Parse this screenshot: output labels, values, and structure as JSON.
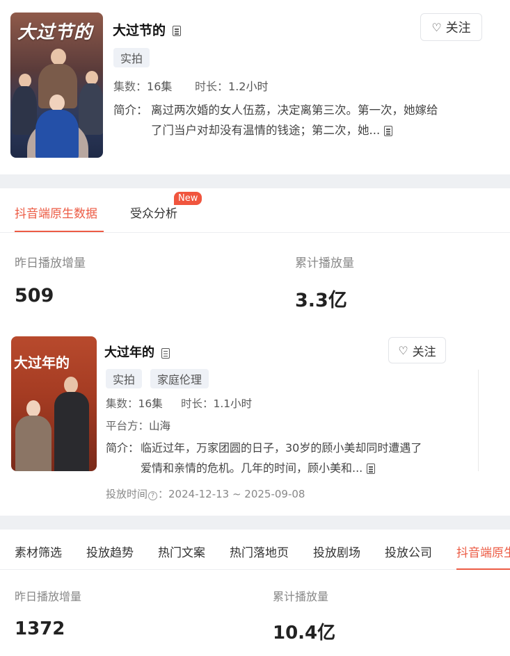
{
  "drama1": {
    "poster_text": "大过节的",
    "title": "大过节的",
    "follow_label": "关注",
    "tags": [
      "实拍"
    ],
    "episodes_label": "集数：",
    "episodes": "16集",
    "duration_label": "时长：",
    "duration": "1.2小时",
    "desc_label": "简介：",
    "desc_line1": "离过两次婚的女人伍荔，决定离第三次。第一次，她嫁给",
    "desc_line2": "了门当户对却没有温情的钱途；第二次，她..."
  },
  "tabs1": {
    "items": [
      "抖音端原生数据",
      "受众分析"
    ],
    "new_badge": "New",
    "active_index": 0
  },
  "stats1": {
    "yesterday_label": "昨日播放增量",
    "yesterday_value": "509",
    "total_label": "累计播放量",
    "total_value": "3.3亿"
  },
  "drama2": {
    "poster_text": "大过年的",
    "title": "大过年的",
    "follow_label": "关注",
    "tags": [
      "实拍",
      "家庭伦理"
    ],
    "episodes_label": "集数：",
    "episodes": "16集",
    "duration_label": "时长：",
    "duration": "1.1小时",
    "platform_label": "平台方：",
    "platform": "山海",
    "desc_label": "简介：",
    "desc_line1": "临近过年，万家团圆的日子，30岁的顾小美却同时遭遇了",
    "desc_line2": "爱情和亲情的危机。几年的时间，顾小美和...",
    "airtime_label": "投放时间",
    "airtime": "：2024-12-13 ~ 2025-09-08"
  },
  "tabs2": {
    "items": [
      "素材筛选",
      "投放趋势",
      "热门文案",
      "热门落地页",
      "投放剧场",
      "投放公司",
      "抖音端原生"
    ],
    "active_index": 6
  },
  "stats2": {
    "yesterday_label": "昨日播放增量",
    "yesterday_value": "1372",
    "total_label": "累计播放量",
    "total_value": "10.4亿"
  },
  "colors": {
    "accent": "#ec5b44",
    "badge": "#f0553e",
    "divider": "#eef0f3"
  }
}
